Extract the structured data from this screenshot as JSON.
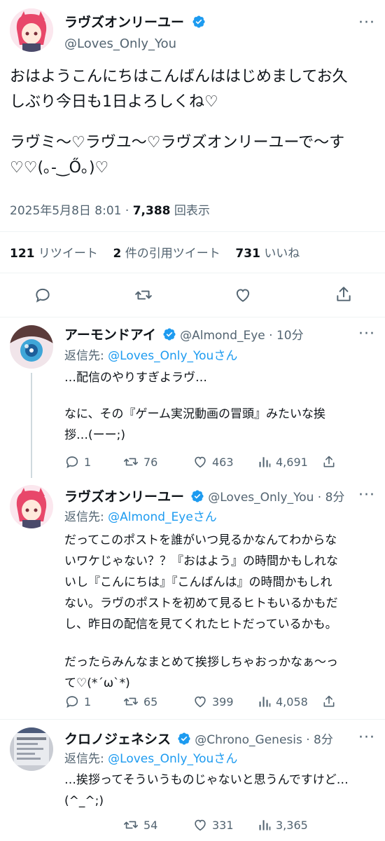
{
  "main_tweet": {
    "display_name": "ラヴズオンリーユー",
    "handle": "@Loves_Only_You",
    "text_line1": "おはようこんにちはこんばんははじめましてお久",
    "text_line2": "しぶり今日も1日よろしくね♡",
    "text_line3": "ラヴミ〜♡ラヴユ〜♡ラヴズオンリーユーで〜す",
    "text_line4": "♡♡(｡-‿Ő｡)♡",
    "timestamp": "2025年5月8日 8:01",
    "dot": "·",
    "views": "7,388",
    "views_label": "回表示",
    "retweets": "121",
    "retweets_label": "リツイート",
    "quotes": "2",
    "quotes_label": "件の引用ツイート",
    "likes": "731",
    "likes_label": "いいね"
  },
  "replies": [
    {
      "display_name": "アーモンドアイ",
      "handle": "@Almond_Eye · 10分",
      "reply_prefix": "返信先:",
      "reply_to": "@Loves_Only_Youさん",
      "lines": [
        "…配信のやりすぎよラヴ…",
        "",
        "なに、その『ゲーム実況動画の冒頭』みたいな挨",
        "拶…(ーー;)"
      ],
      "reply_count": "1",
      "retweet_count": "76",
      "like_count": "463",
      "view_count": "4,691"
    },
    {
      "display_name": "ラヴズオンリーユー",
      "handle": "@Loves_Only_You · 8分",
      "reply_prefix": "返信先:",
      "reply_to": "@Almond_Eyeさん",
      "lines": [
        "だってこのポストを誰がいつ見るかなんてわからな",
        "いワケじゃない？？『おはよう』の時間かもしれな",
        "いし『こんにちは』『こんばんは』の時間かもしれ",
        "ない。ラヴのポストを初めて見るヒトもいるかもだ",
        "し、昨日の配信を見てくれたヒトだっているかも。",
        "",
        "だったらみんなまとめて挨拶しちゃおっかなぁ〜っ",
        "て♡(*´ω`*)"
      ],
      "reply_count": "1",
      "retweet_count": "65",
      "like_count": "399",
      "view_count": "4,058"
    },
    {
      "display_name": "クロノジェネシス",
      "handle": "@Chrono_Genesis · 8分",
      "reply_prefix": "返信先:",
      "reply_to": "@Loves_Only_Youさん",
      "lines": [
        "…挨拶ってそういうものじゃないと思うんですけど…",
        "(^_^;)"
      ],
      "retweet_count": "54",
      "like_count": "331",
      "view_count": "3,365"
    }
  ],
  "colors": {
    "accent": "#1d9bf0",
    "muted": "#536471",
    "text": "#0f1419"
  },
  "icons": [
    "verified-badge-icon",
    "more-icon",
    "reply-icon",
    "retweet-icon",
    "like-icon",
    "share-icon",
    "views-icon"
  ]
}
